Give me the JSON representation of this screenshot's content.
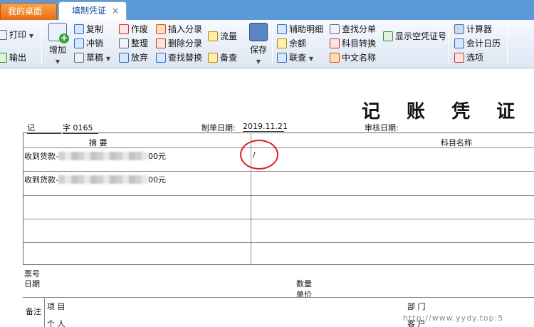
{
  "tabs": {
    "desktop": "我的桌面",
    "voucher": "填制凭证",
    "close": "×"
  },
  "toolbar": {
    "print": "打印",
    "output": "输出",
    "add": "增加",
    "copy": "复制",
    "reverse": "冲销",
    "draft": "草稿",
    "void": "作废",
    "tidy": "整理",
    "discard": "放弃",
    "insert_entry": "插入分录",
    "delete_entry": "删除分录",
    "find_replace": "查找替换",
    "flow": "流量",
    "memo": "备查",
    "save": "保存",
    "aux_detail": "辅助明细",
    "balance": "余额",
    "link_query": "联查",
    "find_entry": "查找分单",
    "account_convert": "科目转换",
    "chinese_name": "中文名称",
    "show_empty_voucher": "显示空凭证号",
    "calculator": "计算器",
    "accounting_calendar": "会计日历",
    "options": "选项"
  },
  "voucher": {
    "title": "记 账 凭 证",
    "type_label": "记",
    "number": "字 0165",
    "date_label": "制单日期:",
    "date_value": "2019.11.21",
    "audit_label": "审核日期:",
    "col_summary": "摘  要",
    "col_account": "科目名称",
    "rows": [
      {
        "summary_prefix": "收到货款-",
        "summary_suffix": "00元",
        "account": "/"
      },
      {
        "summary_prefix": "收到货款-",
        "summary_suffix": "00元",
        "account": ""
      }
    ],
    "ticket_no": "票号",
    "date": "日期",
    "quantity": "数量",
    "unit_price": "单价",
    "remark": "备注",
    "project": "项  目",
    "department": "部  门",
    "person": "个  人",
    "customer": "客  户"
  },
  "watermark": "http://www.yydy.top:5"
}
